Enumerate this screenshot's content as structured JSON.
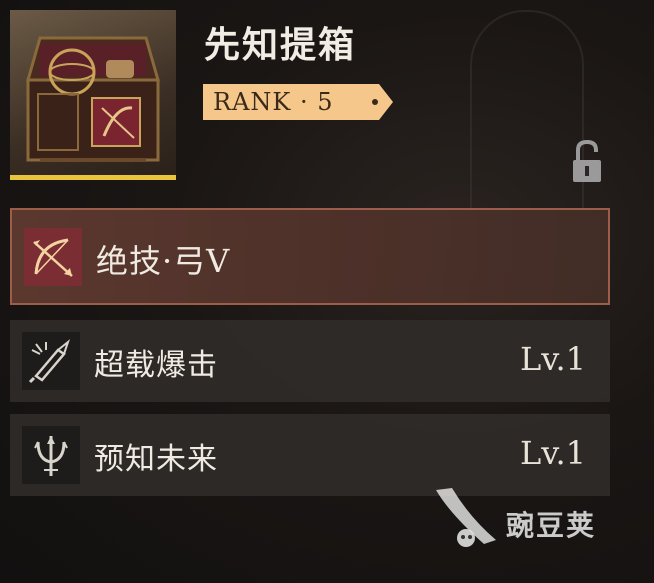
{
  "item": {
    "name": "先知提箱",
    "rank_label": "RANK · 5",
    "icon": "treasure-chest-icon",
    "locked": true
  },
  "skills": [
    {
      "name": "绝技·弓V",
      "level": "",
      "icon": "bow-arrow-icon",
      "active": true
    },
    {
      "name": "超载爆击",
      "level": "Lv.1",
      "icon": "sword-burst-icon",
      "active": false
    },
    {
      "name": "预知未来",
      "level": "Lv.1",
      "icon": "trident-icon",
      "active": false
    }
  ],
  "watermark": {
    "text": "豌豆荚"
  },
  "colors": {
    "rank_tag": "#f5c78a",
    "accent_border": "#9c5e4a",
    "item_underline": "#e8c53a",
    "active_icon_bg": "#7a2e34"
  }
}
